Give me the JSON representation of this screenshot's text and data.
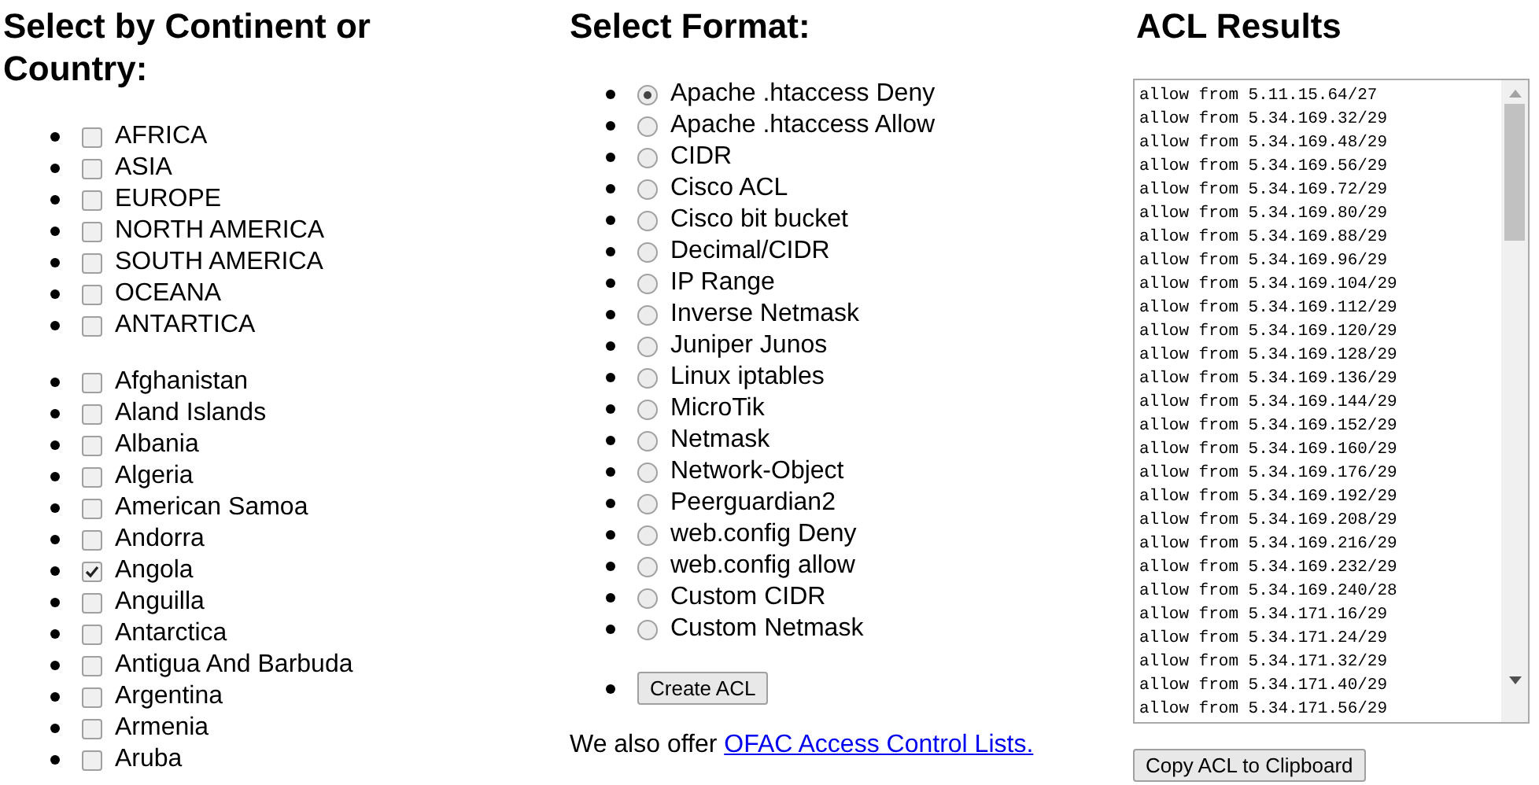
{
  "region_column": {
    "title": "Select by Continent or Country:",
    "continents": [
      {
        "label": "AFRICA",
        "checked": false
      },
      {
        "label": "ASIA",
        "checked": false
      },
      {
        "label": "EUROPE",
        "checked": false
      },
      {
        "label": "NORTH AMERICA",
        "checked": false
      },
      {
        "label": "SOUTH AMERICA",
        "checked": false
      },
      {
        "label": "OCEANA",
        "checked": false
      },
      {
        "label": "ANTARTICA",
        "checked": false
      }
    ],
    "countries": [
      {
        "label": "Afghanistan",
        "checked": false
      },
      {
        "label": "Aland Islands",
        "checked": false
      },
      {
        "label": "Albania",
        "checked": false
      },
      {
        "label": "Algeria",
        "checked": false
      },
      {
        "label": "American Samoa",
        "checked": false
      },
      {
        "label": "Andorra",
        "checked": false
      },
      {
        "label": "Angola",
        "checked": true
      },
      {
        "label": "Anguilla",
        "checked": false
      },
      {
        "label": "Antarctica",
        "checked": false
      },
      {
        "label": "Antigua And Barbuda",
        "checked": false
      },
      {
        "label": "Argentina",
        "checked": false
      },
      {
        "label": "Armenia",
        "checked": false
      },
      {
        "label": "Aruba",
        "checked": false
      }
    ]
  },
  "format_column": {
    "title": "Select Format:",
    "formats": [
      {
        "label": "Apache .htaccess Deny",
        "selected": true
      },
      {
        "label": "Apache .htaccess Allow",
        "selected": false
      },
      {
        "label": "CIDR",
        "selected": false
      },
      {
        "label": "Cisco ACL",
        "selected": false
      },
      {
        "label": "Cisco bit bucket",
        "selected": false
      },
      {
        "label": "Decimal/CIDR",
        "selected": false
      },
      {
        "label": "IP Range",
        "selected": false
      },
      {
        "label": "Inverse Netmask",
        "selected": false
      },
      {
        "label": "Juniper Junos",
        "selected": false
      },
      {
        "label": "Linux iptables",
        "selected": false
      },
      {
        "label": "MicroTik",
        "selected": false
      },
      {
        "label": "Netmask",
        "selected": false
      },
      {
        "label": "Network-Object",
        "selected": false
      },
      {
        "label": "Peerguardian2",
        "selected": false
      },
      {
        "label": "web.config Deny",
        "selected": false
      },
      {
        "label": "web.config allow",
        "selected": false
      },
      {
        "label": "Custom CIDR",
        "selected": false
      },
      {
        "label": "Custom Netmask",
        "selected": false
      }
    ],
    "create_button": "Create ACL",
    "note": "We also offer ",
    "note_link": "OFAC Access Control Lists."
  },
  "results_column": {
    "title": "ACL Results",
    "lines": [
      "allow from 5.11.15.64/27",
      "allow from 5.34.169.32/29",
      "allow from 5.34.169.48/29",
      "allow from 5.34.169.56/29",
      "allow from 5.34.169.72/29",
      "allow from 5.34.169.80/29",
      "allow from 5.34.169.88/29",
      "allow from 5.34.169.96/29",
      "allow from 5.34.169.104/29",
      "allow from 5.34.169.112/29",
      "allow from 5.34.169.120/29",
      "allow from 5.34.169.128/29",
      "allow from 5.34.169.136/29",
      "allow from 5.34.169.144/29",
      "allow from 5.34.169.152/29",
      "allow from 5.34.169.160/29",
      "allow from 5.34.169.176/29",
      "allow from 5.34.169.192/29",
      "allow from 5.34.169.208/29",
      "allow from 5.34.169.216/29",
      "allow from 5.34.169.232/29",
      "allow from 5.34.169.240/28",
      "allow from 5.34.171.16/29",
      "allow from 5.34.171.24/29",
      "allow from 5.34.171.32/29",
      "allow from 5.34.171.40/29",
      "allow from 5.34.171.56/29"
    ],
    "copy_button": "Copy ACL to Clipboard"
  }
}
